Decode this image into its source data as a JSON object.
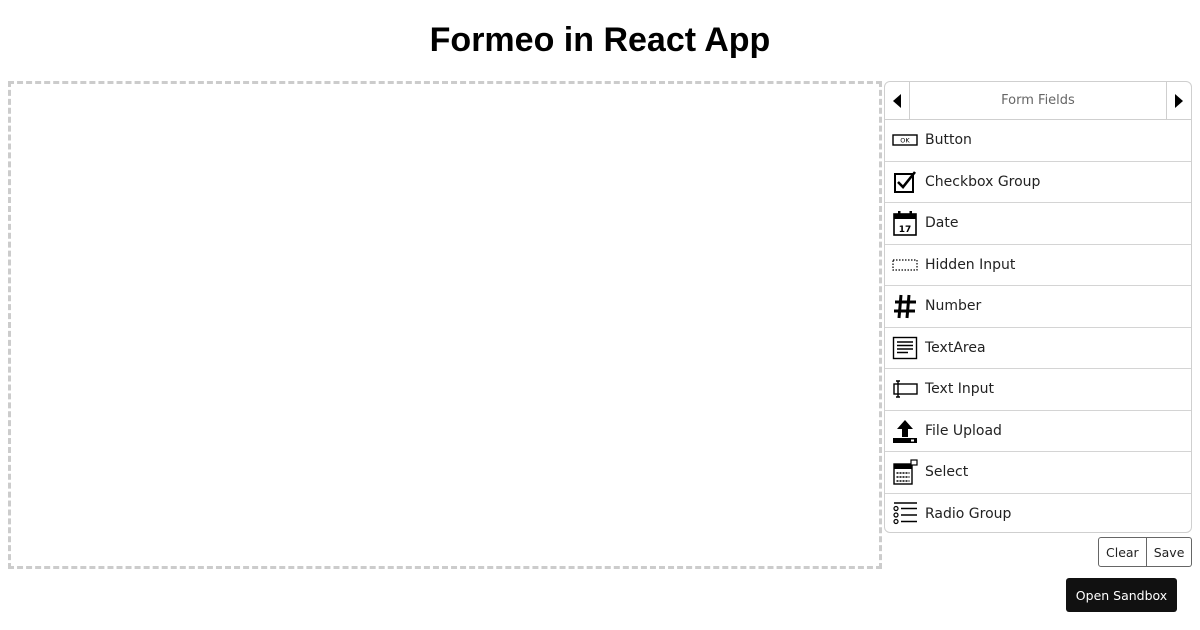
{
  "page": {
    "title": "Formeo in React App"
  },
  "panel": {
    "title": "Form Fields",
    "prev_icon": "caret-left-icon",
    "next_icon": "caret-right-icon",
    "fields": [
      {
        "label": "Button",
        "icon": "button-icon"
      },
      {
        "label": "Checkbox Group",
        "icon": "checkbox-icon"
      },
      {
        "label": "Date",
        "icon": "calendar-icon"
      },
      {
        "label": "Hidden Input",
        "icon": "hidden-input-icon"
      },
      {
        "label": "Number",
        "icon": "hash-icon"
      },
      {
        "label": "TextArea",
        "icon": "textarea-icon"
      },
      {
        "label": "Text Input",
        "icon": "text-input-icon"
      },
      {
        "label": "File Upload",
        "icon": "upload-icon"
      },
      {
        "label": "Select",
        "icon": "select-icon"
      },
      {
        "label": "Radio Group",
        "icon": "radio-group-icon"
      }
    ]
  },
  "actions": {
    "clear_label": "Clear",
    "save_label": "Save"
  },
  "sandbox": {
    "label": "Open Sandbox"
  },
  "colors": {
    "stage_border": "#cccccc",
    "panel_border": "#cfcfcf",
    "sandbox_bg": "#111111"
  }
}
